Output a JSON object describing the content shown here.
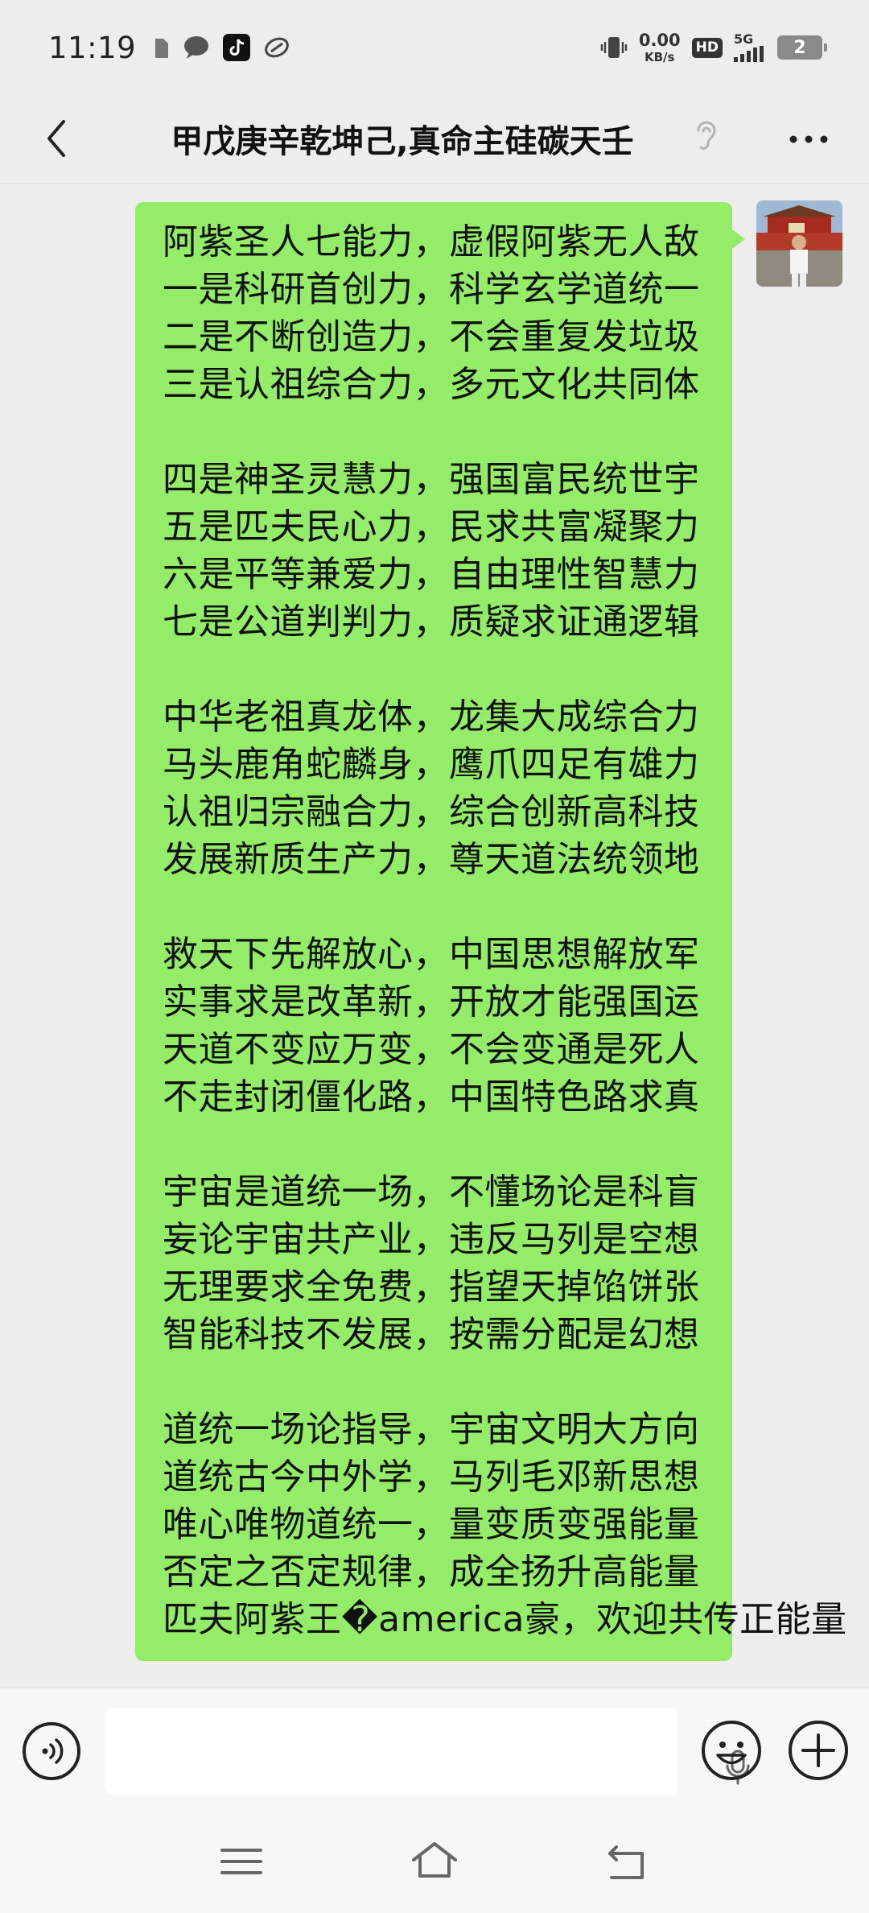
{
  "status_bar": {
    "time": "11:19",
    "net_speed_value": "0.00",
    "net_speed_unit": "KB/s",
    "hd_label": "HD",
    "network_label": "5G",
    "battery_label": "2"
  },
  "header": {
    "title": "甲戊庚辛乾坤己,真命主硅碳天壬",
    "icons": [
      "back-arrow-icon",
      "ear-icon",
      "more-icon"
    ]
  },
  "message": {
    "stanzas": [
      [
        "阿紫圣人七能力，虚假阿紫无人敌",
        "一是科研首创力，科学玄学道统一",
        "二是不断创造力，不会重复发垃圾",
        "三是认祖综合力，多元文化共同体"
      ],
      [
        "四是神圣灵慧力，强国富民统世宇",
        "五是匹夫民心力，民求共富凝聚力",
        "六是平等兼爱力，自由理性智慧力",
        "七是公道判判力，质疑求证通逻辑"
      ],
      [
        "中华老祖真龙体，龙集大成综合力",
        "马头鹿角蛇麟身，鹰爪四足有雄力",
        "认祖归宗融合力，综合创新高科技",
        "发展新质生产力，尊天道法统领地"
      ],
      [
        "救天下先解放心，中国思想解放军",
        "实事求是改革新，开放才能强国运",
        "天道不变应万变，不会变通是死人",
        "不走封闭僵化路，中国特色路求真"
      ],
      [
        "宇宙是道统一场，不懂场论是科盲",
        "妄论宇宙共产业，违反马列是空想",
        "无理要求全免费，指望天掉馅饼张",
        "智能科技不发展，按需分配是幻想"
      ],
      [
        "道统一场论指导，宇宙文明大方向",
        "道统古今中外学，马列毛邓新思想",
        "唯心唯物道统一，量变质变强能量",
        "否定之否定规律，成全扬升高能量",
        "匹夫阿紫王�america豪，欢迎共传正能量"
      ]
    ]
  },
  "colors": {
    "background": "#ededed",
    "bubble": "#95ec69",
    "bars": "#f7f7f7"
  }
}
